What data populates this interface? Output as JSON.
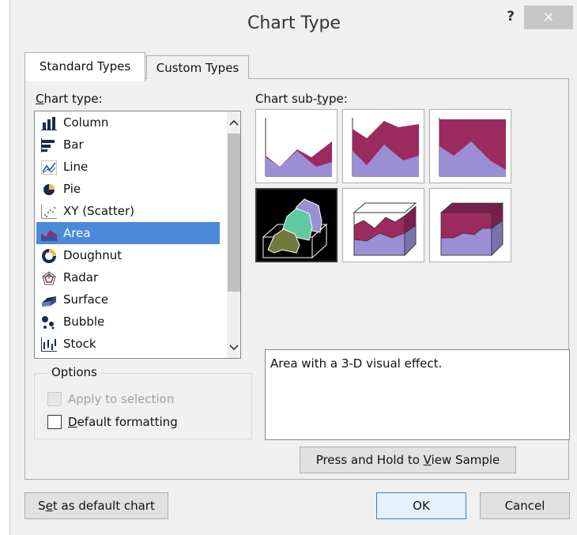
{
  "window": {
    "title": "Chart Type",
    "help_glyph": "?",
    "close_glyph": "×"
  },
  "tabs": [
    {
      "label": "Standard Types",
      "active": true
    },
    {
      "label": "Custom Types",
      "active": false
    }
  ],
  "chart_type_label": {
    "pre": "",
    "u": "C",
    "post": "hart type:"
  },
  "chart_types": [
    {
      "label": "Column",
      "icon": "column-chart-icon"
    },
    {
      "label": "Bar",
      "icon": "bar-chart-icon"
    },
    {
      "label": "Line",
      "icon": "line-chart-icon"
    },
    {
      "label": "Pie",
      "icon": "pie-chart-icon"
    },
    {
      "label": "XY (Scatter)",
      "icon": "scatter-chart-icon"
    },
    {
      "label": "Area",
      "icon": "area-chart-icon",
      "selected": true
    },
    {
      "label": "Doughnut",
      "icon": "doughnut-chart-icon"
    },
    {
      "label": "Radar",
      "icon": "radar-chart-icon"
    },
    {
      "label": "Surface",
      "icon": "surface-chart-icon"
    },
    {
      "label": "Bubble",
      "icon": "bubble-chart-icon"
    },
    {
      "label": "Stock",
      "icon": "stock-chart-icon"
    }
  ],
  "subtype_label": {
    "pre": "Chart sub-",
    "u": "t",
    "post": "ype:"
  },
  "subtypes": [
    {
      "name": "area",
      "selected": false
    },
    {
      "name": "stacked-area",
      "selected": false
    },
    {
      "name": "100-percent-stacked-area",
      "selected": false
    },
    {
      "name": "3d-area",
      "selected": true
    },
    {
      "name": "3d-stacked-area",
      "selected": false
    },
    {
      "name": "3d-100-percent-stacked-area",
      "selected": false
    }
  ],
  "description": "Area with a 3-D visual effect.",
  "options": {
    "legend": "Options",
    "apply_to_selection": {
      "label": "Apply to selection",
      "checked": false,
      "disabled": true
    },
    "default_formatting": {
      "pre": "",
      "u": "D",
      "post": "efault formatting",
      "checked": false
    }
  },
  "sample_button": {
    "pre": "Press and Hold to ",
    "u": "V",
    "post": "iew Sample"
  },
  "set_default_button": {
    "pre": "S",
    "u": "e",
    "post": "t as default chart"
  },
  "ok_label": "OK",
  "cancel_label": "Cancel",
  "colors": {
    "area_purple": "#9a8fd4",
    "area_maroon": "#9b2a5f",
    "selection_blue": "#4a8ad8",
    "area_teal": "#5fc9a0",
    "area_olive": "#707a3a"
  }
}
